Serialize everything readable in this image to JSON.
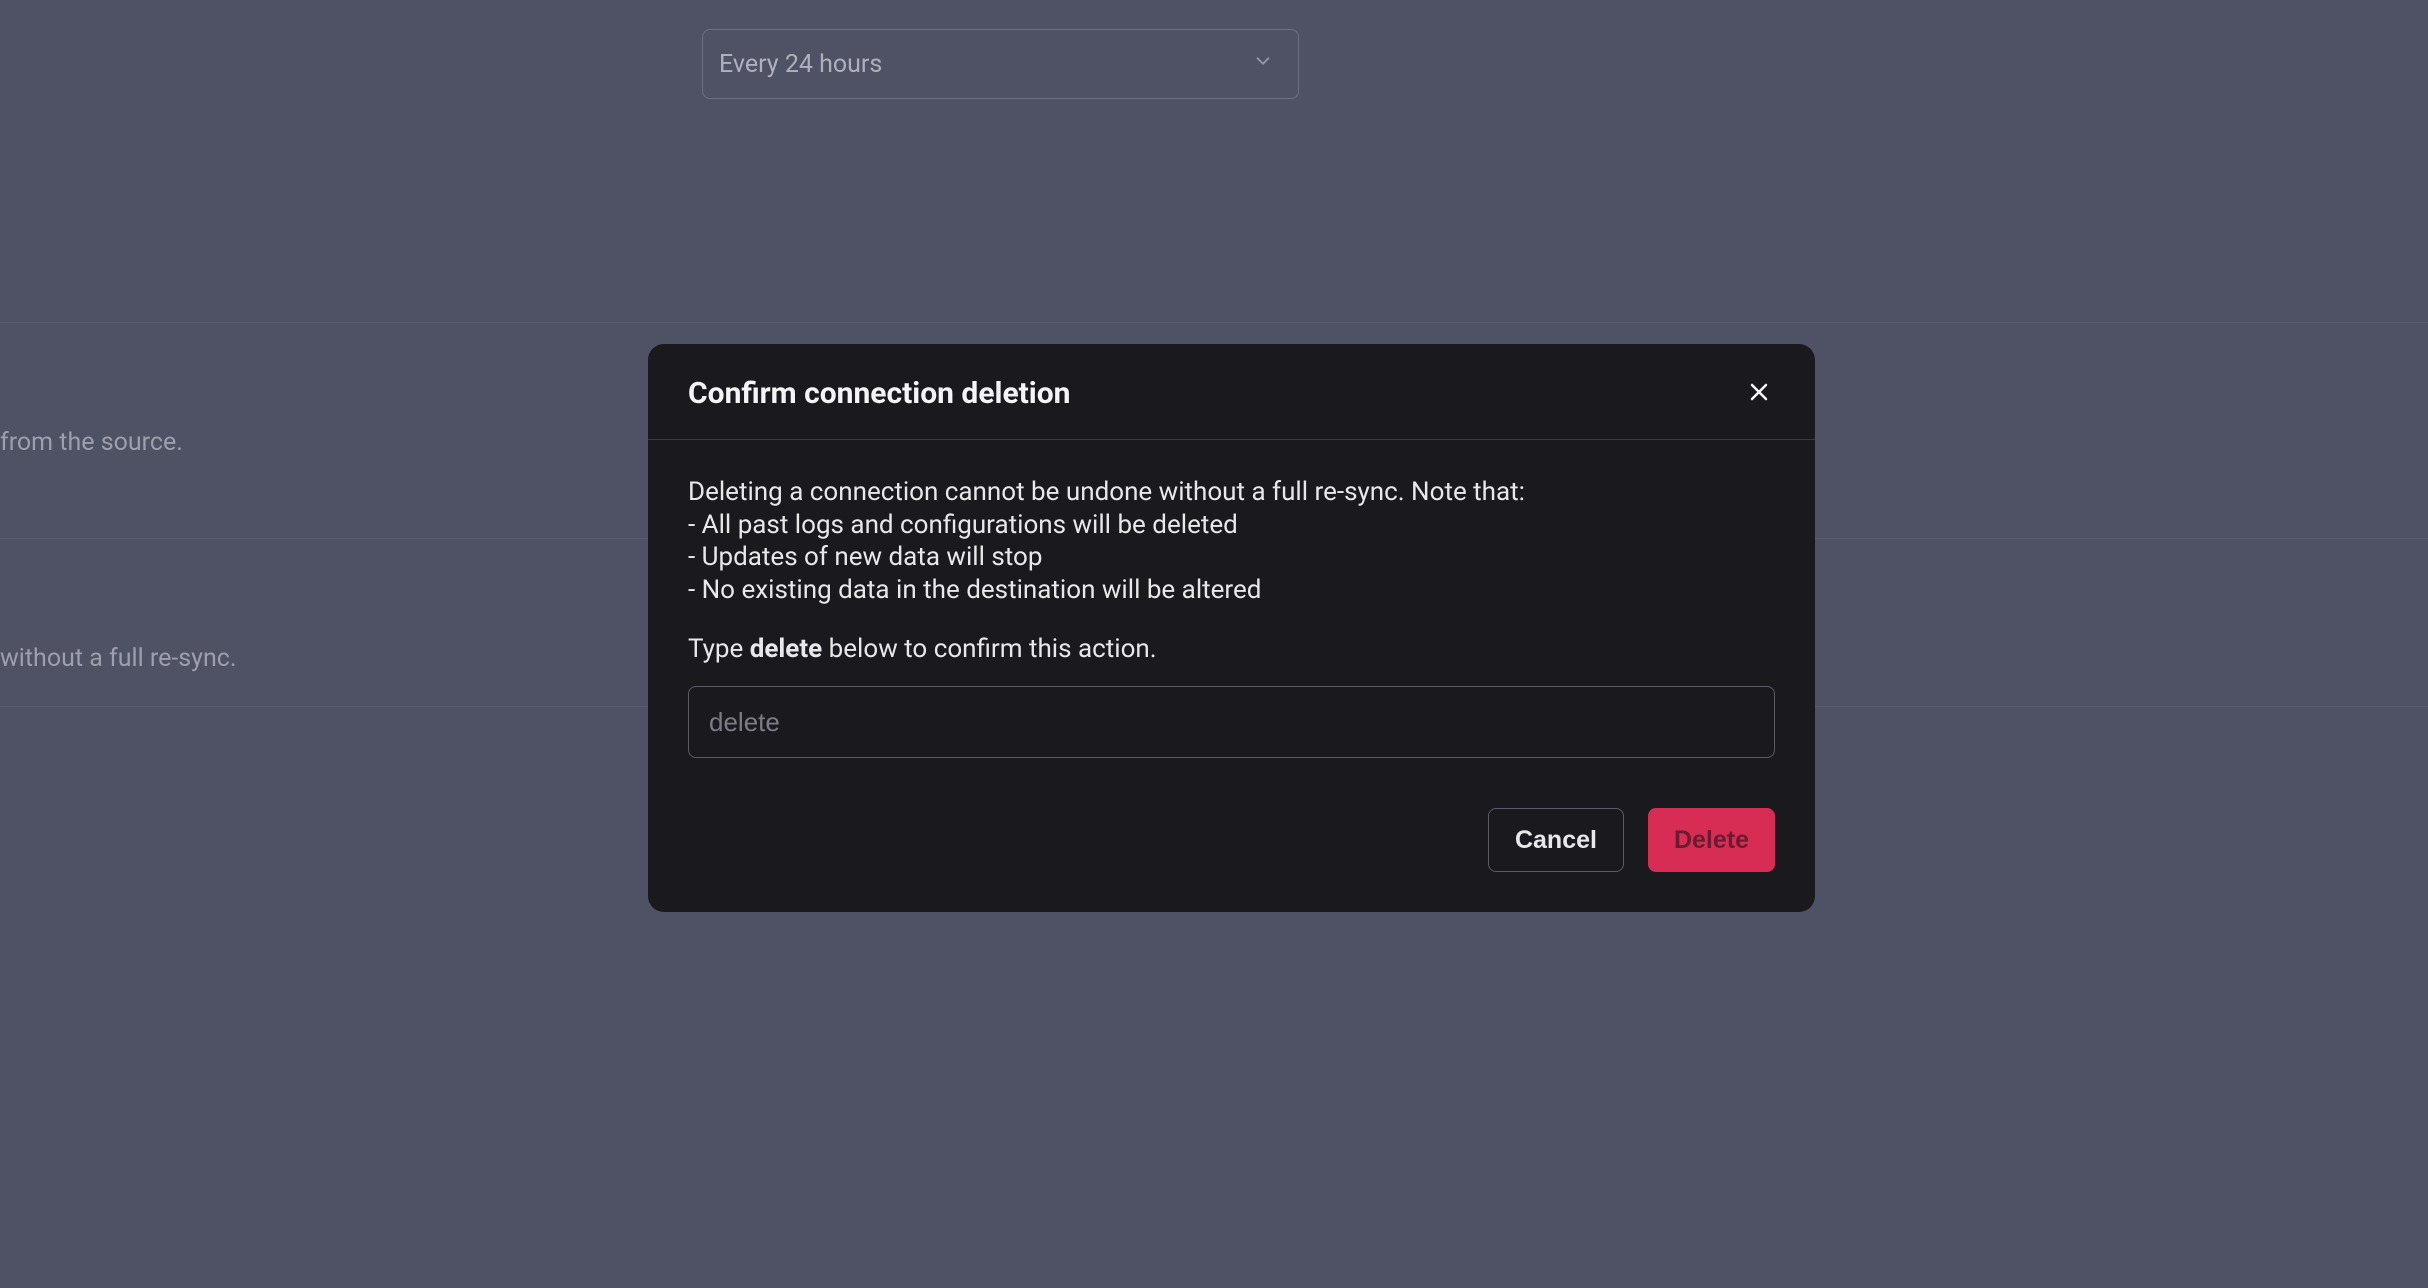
{
  "background": {
    "select_value": "Every 24 hours",
    "text_1": "from the source.",
    "text_2": "without a full re-sync."
  },
  "modal": {
    "title": "Confirm connection deletion",
    "warning_intro": "Deleting a connection cannot be undone without a full re-sync. Note that:",
    "warning_item_1": "- All past logs and configurations will be deleted",
    "warning_item_2": "- Updates of new data will stop",
    "warning_item_3": "- No existing data in the destination will be altered",
    "confirm_prompt_prefix": "Type ",
    "confirm_prompt_keyword": "delete",
    "confirm_prompt_suffix": " below to confirm this action.",
    "input_placeholder": "delete",
    "input_value": "",
    "cancel_label": "Cancel",
    "delete_label": "Delete"
  }
}
